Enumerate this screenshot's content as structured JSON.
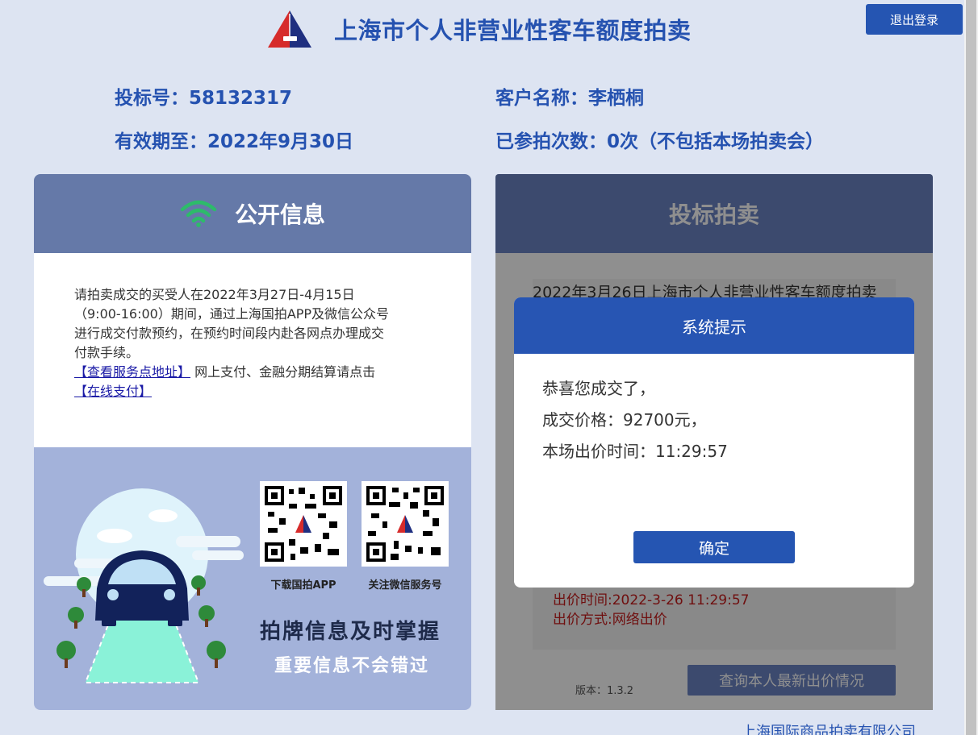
{
  "header": {
    "title": "上海市个人非营业性客车额度拍卖",
    "logout_label": "退出登录"
  },
  "user_info": {
    "bid_number_label": "投标号：",
    "bid_number": "58132317",
    "valid_until_label": "有效期至：",
    "valid_until": "2022年9月30日",
    "customer_name_label": "客户名称：",
    "customer_name": "李栖桐",
    "auction_count_label": "已参拍次数：",
    "auction_count": "0次（不包括本场拍卖会）"
  },
  "public_info": {
    "title": "公开信息",
    "paragraph_lines": [
      "请拍卖成交的买受人在2022年3月27日-4月15日",
      "（9:00-16:00）期间，通过上海国拍APP及微信公众号",
      "进行成交付款预约，在预约时间段内赴各网点办理成交",
      "付款手续。"
    ],
    "service_link": "【查看服务点地址】",
    "online_text": " 网上支付、金融分期结算请点击",
    "pay_link": "【在线支付】"
  },
  "promo": {
    "qr_app_label": "下载国拍APP",
    "qr_wechat_label": "关注微信服务号",
    "headline": "拍牌信息及时掌握",
    "subline": "重要信息不会错过"
  },
  "bidding": {
    "title": "投标拍卖",
    "auction_title": "2022年3月26日上海市个人非营业性客车额度拍卖",
    "bid_time": "出价时间:2022-3-26 11:29:57",
    "bid_method": "出价方式:网络出价",
    "version": "版本：1.3.2",
    "query_label": "查询本人最新出价情况"
  },
  "footer": {
    "company": "上海国际商品拍卖有限公司"
  },
  "dialog": {
    "title": "系统提示",
    "line1": "恭喜您成交了，",
    "line2": "成交价格：92700元，",
    "line3": "本场出价时间：11:29:57",
    "ok_label": "确定"
  },
  "colors": {
    "brand_blue": "#2552b0",
    "panel_header_left": "#6579a8",
    "panel_header_right": "#6c84c4",
    "wifi_green": "#2dbb6a",
    "red_text": "#c71b1b"
  }
}
